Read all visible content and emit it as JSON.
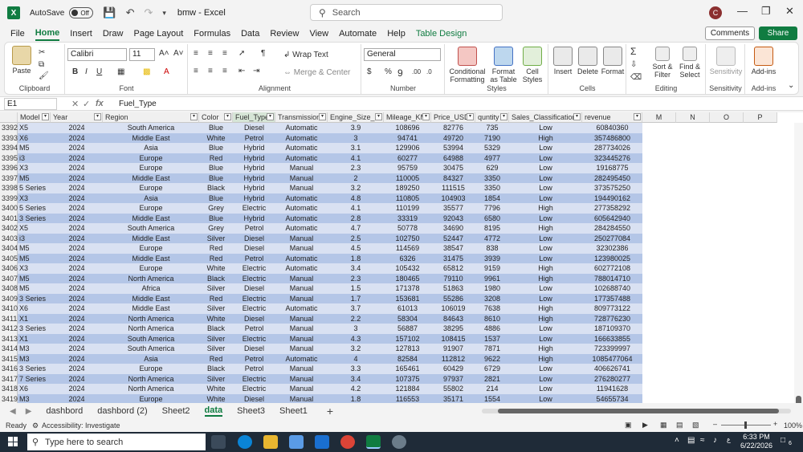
{
  "titlebar": {
    "autosave": "AutoSave",
    "toggle": "Off",
    "doc_title": "bmw  -  Excel",
    "search_placeholder": "Search",
    "avatar_initial": "C"
  },
  "menu_tabs": [
    "File",
    "Home",
    "Insert",
    "Draw",
    "Page Layout",
    "Formulas",
    "Data",
    "Review",
    "View",
    "Automate",
    "Help",
    "Table Design"
  ],
  "comments": "Comments",
  "share": "Share",
  "ribbon": {
    "clipboard": {
      "label": "Clipboard",
      "paste": "Paste"
    },
    "font": {
      "label": "Font",
      "name": "Calibri",
      "size": "11"
    },
    "alignment": {
      "label": "Alignment",
      "wrap": "Wrap Text",
      "merge": "Merge & Center"
    },
    "number": {
      "label": "Number",
      "format": "General"
    },
    "styles": {
      "label": "Styles",
      "conditional": "Conditional Formatting",
      "format_table": "Format as Table",
      "cell_styles": "Cell Styles"
    },
    "cells": {
      "label": "Cells",
      "insert": "Insert",
      "delete": "Delete",
      "format": "Format"
    },
    "editing": {
      "label": "Editing",
      "sort": "Sort & Filter",
      "find": "Find & Select"
    },
    "sensitivity": {
      "label": "Sensitivity",
      "btn": "Sensitivity"
    },
    "addins": {
      "label": "Add-ins",
      "btn": "Add-ins"
    }
  },
  "formula": {
    "namebox": "E1",
    "value": "Fuel_Type"
  },
  "columns": [
    "Model",
    "Year",
    "Region",
    "Color",
    "Fuel_Type",
    "Transmission",
    "Engine_Size_L",
    "Mileage_KM",
    "Price_USD",
    "quntity",
    "Sales_Classification",
    "revenue"
  ],
  "extra_columns": [
    "M",
    "N",
    "O",
    "P"
  ],
  "rows": [
    [
      "3392",
      "X5",
      "2024",
      "South America",
      "Blue",
      "Diesel",
      "Automatic",
      "3.9",
      "108696",
      "82776",
      "735",
      "Low",
      "60840360"
    ],
    [
      "3393",
      "X6",
      "2024",
      "Middle East",
      "White",
      "Petrol",
      "Automatic",
      "3",
      "94741",
      "49720",
      "7190",
      "High",
      "357486800"
    ],
    [
      "3394",
      "M5",
      "2024",
      "Asia",
      "Blue",
      "Hybrid",
      "Automatic",
      "3.1",
      "129906",
      "53994",
      "5329",
      "Low",
      "287734026"
    ],
    [
      "3395",
      "i3",
      "2024",
      "Europe",
      "Red",
      "Hybrid",
      "Automatic",
      "4.1",
      "60277",
      "64988",
      "4977",
      "Low",
      "323445276"
    ],
    [
      "3396",
      "X3",
      "2024",
      "Europe",
      "Blue",
      "Hybrid",
      "Manual",
      "2.3",
      "95759",
      "30475",
      "629",
      "Low",
      "19168775"
    ],
    [
      "3397",
      "M5",
      "2024",
      "Middle East",
      "Blue",
      "Hybrid",
      "Manual",
      "2",
      "110005",
      "84327",
      "3350",
      "Low",
      "282495450"
    ],
    [
      "3398",
      "5 Series",
      "2024",
      "Europe",
      "Black",
      "Hybrid",
      "Manual",
      "3.2",
      "189250",
      "111515",
      "3350",
      "Low",
      "373575250"
    ],
    [
      "3399",
      "X3",
      "2024",
      "Asia",
      "Blue",
      "Hybrid",
      "Automatic",
      "4.8",
      "110805",
      "104903",
      "1854",
      "Low",
      "194490162"
    ],
    [
      "3400",
      "5 Series",
      "2024",
      "Europe",
      "Grey",
      "Electric",
      "Automatic",
      "4.1",
      "110199",
      "35577",
      "7796",
      "High",
      "277358292"
    ],
    [
      "3401",
      "3 Series",
      "2024",
      "Middle East",
      "Blue",
      "Hybrid",
      "Automatic",
      "2.8",
      "33319",
      "92043",
      "6580",
      "Low",
      "605642940"
    ],
    [
      "3402",
      "X5",
      "2024",
      "South America",
      "Grey",
      "Petrol",
      "Automatic",
      "4.7",
      "50778",
      "34690",
      "8195",
      "High",
      "284284550"
    ],
    [
      "3403",
      "i3",
      "2024",
      "Middle East",
      "Silver",
      "Diesel",
      "Manual",
      "2.5",
      "102750",
      "52447",
      "4772",
      "Low",
      "250277084"
    ],
    [
      "3404",
      "M5",
      "2024",
      "Europe",
      "Red",
      "Diesel",
      "Manual",
      "4.5",
      "114569",
      "38547",
      "838",
      "Low",
      "32302386"
    ],
    [
      "3405",
      "M5",
      "2024",
      "Middle East",
      "Red",
      "Petrol",
      "Automatic",
      "1.8",
      "6326",
      "31475",
      "3939",
      "Low",
      "123980025"
    ],
    [
      "3406",
      "X3",
      "2024",
      "Europe",
      "White",
      "Electric",
      "Automatic",
      "3.4",
      "105432",
      "65812",
      "9159",
      "High",
      "602772108"
    ],
    [
      "3407",
      "M5",
      "2024",
      "North America",
      "Black",
      "Electric",
      "Manual",
      "2.3",
      "180465",
      "79110",
      "9961",
      "High",
      "788014710"
    ],
    [
      "3408",
      "M5",
      "2024",
      "Africa",
      "Silver",
      "Diesel",
      "Manual",
      "1.5",
      "171378",
      "51863",
      "1980",
      "Low",
      "102688740"
    ],
    [
      "3409",
      "3 Series",
      "2024",
      "Middle East",
      "Red",
      "Electric",
      "Manual",
      "1.7",
      "153681",
      "55286",
      "3208",
      "Low",
      "177357488"
    ],
    [
      "3410",
      "X6",
      "2024",
      "Middle East",
      "Silver",
      "Electric",
      "Automatic",
      "3.7",
      "61013",
      "106019",
      "7638",
      "High",
      "809773122"
    ],
    [
      "3411",
      "X1",
      "2024",
      "North America",
      "White",
      "Diesel",
      "Manual",
      "2.2",
      "58304",
      "84643",
      "8610",
      "High",
      "728776230"
    ],
    [
      "3412",
      "3 Series",
      "2024",
      "North America",
      "Black",
      "Petrol",
      "Manual",
      "3",
      "56887",
      "38295",
      "4886",
      "Low",
      "187109370"
    ],
    [
      "3413",
      "X1",
      "2024",
      "South America",
      "Silver",
      "Electric",
      "Manual",
      "4.3",
      "157102",
      "108415",
      "1537",
      "Low",
      "166633855"
    ],
    [
      "3414",
      "M3",
      "2024",
      "South America",
      "Silver",
      "Diesel",
      "Manual",
      "3.2",
      "127813",
      "91907",
      "7871",
      "High",
      "723399997"
    ],
    [
      "3415",
      "M3",
      "2024",
      "Asia",
      "Red",
      "Petrol",
      "Automatic",
      "4",
      "82584",
      "112812",
      "9622",
      "High",
      "1085477064"
    ],
    [
      "3416",
      "3 Series",
      "2024",
      "Europe",
      "Black",
      "Petrol",
      "Manual",
      "3.3",
      "165461",
      "60429",
      "6729",
      "Low",
      "406626741"
    ],
    [
      "3417",
      "7 Series",
      "2024",
      "North America",
      "Silver",
      "Electric",
      "Manual",
      "3.4",
      "107375",
      "97937",
      "2821",
      "Low",
      "276280277"
    ],
    [
      "3418",
      "X6",
      "2024",
      "North America",
      "White",
      "Electric",
      "Manual",
      "4.2",
      "121884",
      "55802",
      "214",
      "Low",
      "11941628"
    ],
    [
      "3419",
      "M3",
      "2024",
      "Europe",
      "White",
      "Diesel",
      "Manual",
      "1.8",
      "116553",
      "35171",
      "1554",
      "Low",
      "54655734"
    ]
  ],
  "sheets": [
    "dashbord",
    "dashbord (2)",
    "Sheet2",
    "data",
    "Sheet3",
    "Sheet1"
  ],
  "active_sheet": "data",
  "status": {
    "ready": "Ready",
    "accessibility": "Accessibility: Investigate",
    "zoom": "100%"
  },
  "taskbar": {
    "search_placeholder": "Type here to search",
    "time": "6:33 PM",
    "date": "6/22/2026",
    "notif_count": "6"
  },
  "colors": {
    "excel_green": "#107c41",
    "band_light": "#d9e1f2",
    "band_dark": "#b4c6e7",
    "taskbar": "#1f2b38"
  }
}
